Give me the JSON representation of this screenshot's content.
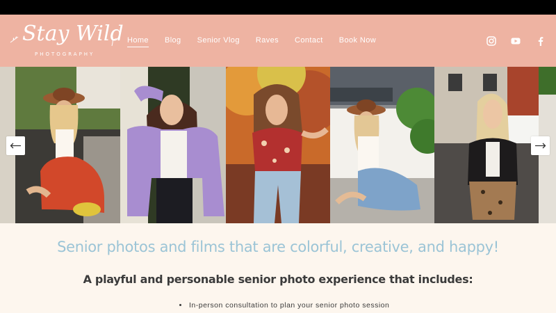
{
  "brand": {
    "script": "Stay Wild",
    "subtitle": "PHOTOGRAPHY",
    "header_color": "#eeb3a2",
    "accent_blue": "#9bc4d6"
  },
  "nav": {
    "items": [
      {
        "label": "Home",
        "active": true
      },
      {
        "label": "Blog"
      },
      {
        "label": "Senior Vlog"
      },
      {
        "label": "Raves"
      },
      {
        "label": "Contact"
      },
      {
        "label": "Book Now"
      }
    ]
  },
  "social": [
    "instagram-icon",
    "youtube-icon",
    "facebook-icon"
  ],
  "gallery": {
    "photos": [
      "senior-photo-red-skirt",
      "senior-photo-purple-cardigan",
      "senior-photo-floral-top",
      "senior-photo-denim-skirt",
      "senior-photo-leather-jacket"
    ],
    "prev_icon": "arrow-left-icon",
    "next_icon": "arrow-right-icon"
  },
  "content": {
    "tagline": "Senior photos and films that are colorful, creative, and happy!",
    "subtitle": "A playful and personable senior photo experience that includes:",
    "bullets": [
      "In-person consultation to plan your senior photo session"
    ]
  }
}
